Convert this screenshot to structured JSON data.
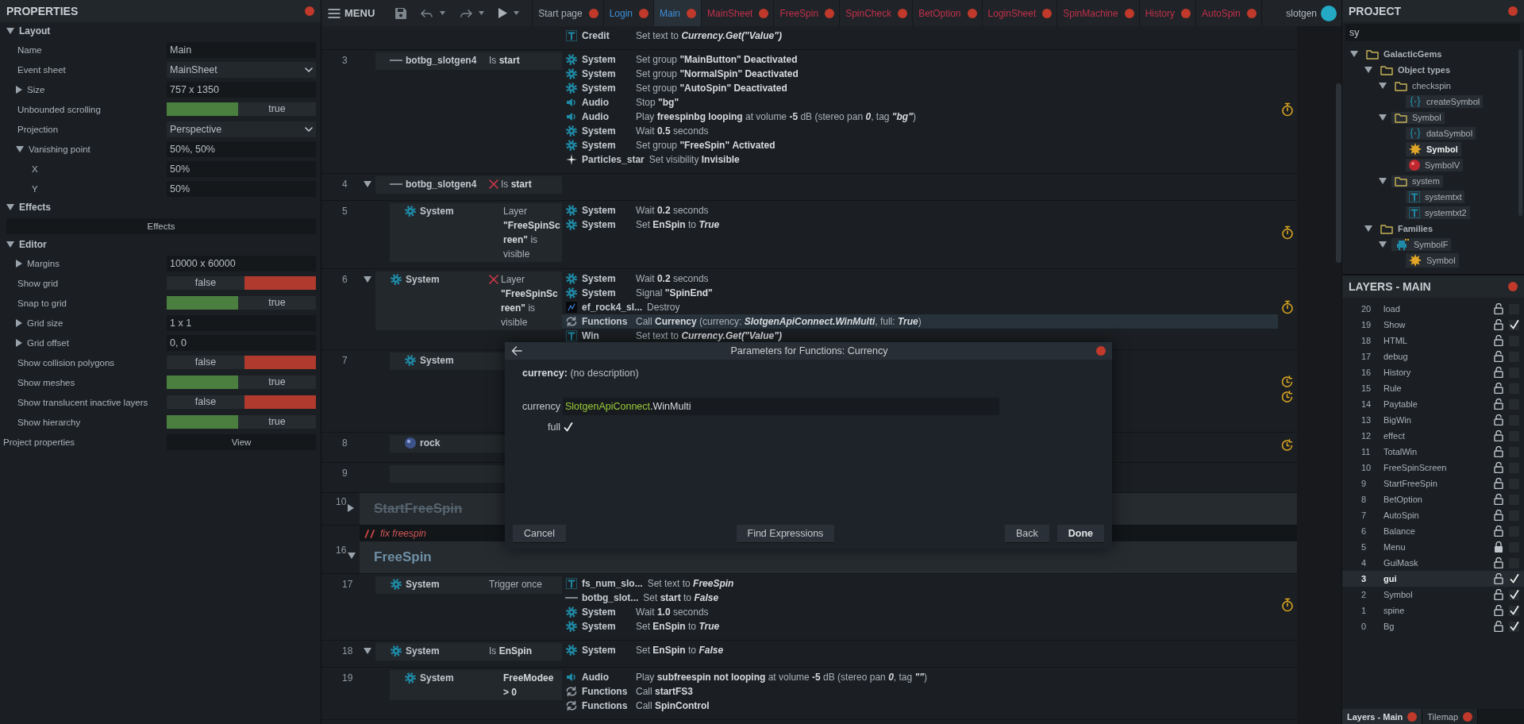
{
  "properties": {
    "title": "PROPERTIES",
    "sections": [
      {
        "title": "Layout",
        "expanded": true,
        "rows": [
          {
            "kind": "text",
            "label": "Name",
            "value": "Main"
          },
          {
            "kind": "dropdown",
            "label": "Event sheet",
            "value": "MainSheet"
          },
          {
            "kind": "text",
            "label": "Size",
            "value": "757 x 1350",
            "expanded": false
          },
          {
            "kind": "toggle",
            "label": "Unbounded scrolling",
            "on": true,
            "value": "true"
          },
          {
            "kind": "dropdown",
            "label": "Projection",
            "value": "Perspective"
          },
          {
            "kind": "text",
            "label": "Vanishing point",
            "value": "50%, 50%",
            "expanded": true,
            "children": [
              {
                "kind": "text",
                "label": "X",
                "value": "50%"
              },
              {
                "kind": "text",
                "label": "Y",
                "value": "50%"
              }
            ]
          }
        ]
      },
      {
        "title": "Effects",
        "expanded": true,
        "rows": [
          {
            "kind": "button",
            "label": "Effects"
          }
        ]
      },
      {
        "title": "Editor",
        "expanded": true,
        "rows": [
          {
            "kind": "text",
            "label": "Margins",
            "value": "10000 x 60000",
            "expanded": false
          },
          {
            "kind": "toggle",
            "label": "Show grid",
            "on": false,
            "value": "false"
          },
          {
            "kind": "toggle",
            "label": "Snap to grid",
            "on": true,
            "value": "true"
          },
          {
            "kind": "text",
            "label": "Grid size",
            "value": "1 x 1",
            "expanded": false
          },
          {
            "kind": "text",
            "label": "Grid offset",
            "value": "0, 0",
            "expanded": false
          },
          {
            "kind": "toggle",
            "label": "Show collision polygons",
            "on": false,
            "value": "false"
          },
          {
            "kind": "toggle",
            "label": "Show meshes",
            "on": true,
            "value": "true"
          },
          {
            "kind": "toggle",
            "label": "Show translucent inactive layers",
            "on": false,
            "value": "false"
          },
          {
            "kind": "toggle",
            "label": "Show hierarchy",
            "on": true,
            "value": "true"
          }
        ]
      }
    ],
    "footer": {
      "label": "Project properties",
      "button": "View"
    }
  },
  "toolbar": {
    "menu": "MENU",
    "tabs": [
      {
        "label": "Start page",
        "kind": "page",
        "selected": false
      },
      {
        "label": "Login",
        "kind": "layout",
        "selected": false
      },
      {
        "label": "Main",
        "kind": "layout",
        "selected": true
      },
      {
        "label": "MainSheet",
        "kind": "sheet",
        "selected": false
      },
      {
        "label": "FreeSpin",
        "kind": "sheet",
        "selected": false
      },
      {
        "label": "SpinCheck",
        "kind": "sheet",
        "selected": false
      },
      {
        "label": "BetOption",
        "kind": "sheet",
        "selected": false
      },
      {
        "label": "LoginSheet",
        "kind": "sheet",
        "selected": false
      },
      {
        "label": "SpinMachine",
        "kind": "sheet",
        "selected": false
      },
      {
        "label": "History",
        "kind": "sheet",
        "selected": false
      },
      {
        "label": "AutoSpin",
        "kind": "sheet",
        "selected": false
      }
    ],
    "user": "slotgen"
  },
  "event_sheet": {
    "events": [
      {
        "kind": "event",
        "actions": [
          {
            "kind": "text",
            "object": "Credit",
            "text": "Set text to *Currency.Get(\"Value\")*",
            "selected": false
          }
        ]
      },
      {
        "kind": "event",
        "number": "3",
        "conditions": [
          {
            "kind": "line",
            "object": "botbg_slotgen4",
            "text": "Is **start**",
            "inverted": false
          }
        ],
        "actions": [
          {
            "kind": "gear",
            "object": "System",
            "text": "Set group **\"MainButton\"** **Deactivated**",
            "selected": false
          },
          {
            "kind": "gear",
            "object": "System",
            "text": "Set group **\"NormalSpin\"** **Deactivated**",
            "selected": false
          },
          {
            "kind": "gear",
            "object": "System",
            "text": "Set group **\"AutoSpin\"** **Deactivated**",
            "selected": false
          },
          {
            "kind": "audio",
            "object": "Audio",
            "text": "Stop **\"bg\"**",
            "selected": false
          },
          {
            "kind": "audio",
            "object": "Audio",
            "text": "Play **freespinbg looping** at volume **-5** dB (stereo pan *0*, tag *\"bg\"*)",
            "selected": false
          },
          {
            "kind": "gear",
            "object": "System",
            "text": "Wait **0.5** seconds",
            "selected": false
          },
          {
            "kind": "gear",
            "object": "System",
            "text": "Set group **\"FreeSpin\"** **Activated**",
            "selected": false
          },
          {
            "kind": "particles",
            "object": "Particles_star",
            "text": "Set visibility **Invisible**",
            "selected": false
          }
        ],
        "markers": [
          {
            "kind": "timer"
          }
        ]
      },
      {
        "kind": "event",
        "number": "4",
        "expanded": true,
        "conditions": [
          {
            "kind": "line",
            "object": "botbg_slotgen4",
            "text": "Is **start**",
            "inverted": true
          }
        ],
        "children": [
          {
            "kind": "event",
            "number": "5",
            "conditions": [
              {
                "kind": "gear",
                "object": "System",
                "text": "Layer **\"FreeSpinScreen\"** is visible",
                "inverted": false
              }
            ],
            "actions": [
              {
                "kind": "gear",
                "object": "System",
                "text": "Wait **0.2** seconds",
                "selected": false
              },
              {
                "kind": "gear",
                "object": "System",
                "text": "Set **EnSpin** to *True*",
                "selected": false
              }
            ],
            "markers": [
              {
                "kind": "timer"
              }
            ]
          }
        ]
      },
      {
        "kind": "event",
        "number": "6",
        "expanded": true,
        "conditions": [
          {
            "kind": "gear",
            "object": "System",
            "text": "Layer **\"FreeSpinScreen\"** is visible",
            "inverted": true
          }
        ],
        "actions": [
          {
            "kind": "gear",
            "object": "System",
            "text": "Wait **0.2** seconds",
            "selected": false
          },
          {
            "kind": "gear",
            "object": "System",
            "text": "Signal **\"SpinEnd\"**",
            "selected": false
          },
          {
            "kind": "sprite",
            "object": "ef_rock4_sl...",
            "text": "Destroy",
            "selected": false
          },
          {
            "kind": "functions",
            "object": "Functions",
            "text": "Call **Currency** (currency: *SlotgenApiConnect.WinMulti*, full: *True*)",
            "selected": true
          },
          {
            "kind": "text",
            "object": "Win",
            "text": "Set text to *Currency.Get(\"Value\")*",
            "selected": false
          }
        ],
        "markers": [
          {
            "kind": "timer"
          }
        ],
        "children": [
          {
            "kind": "event",
            "number": "7",
            "conditions": [
              {
                "kind": "gear",
                "object": "System",
                "inverted": false
              }
            ],
            "markers": [
              {
                "kind": "repeat"
              },
              {
                "kind": "repeat"
              }
            ]
          },
          {
            "kind": "event",
            "number": "8",
            "conditions": [
              {
                "kind": "sphere",
                "object": "rock",
                "inverted": false
              }
            ],
            "markers": [
              {
                "kind": "repeat"
              }
            ]
          },
          {
            "kind": "event",
            "number": "9"
          }
        ]
      },
      {
        "kind": "group",
        "number": "10",
        "title": "StartFreeSpin",
        "expanded": false,
        "disabled": true
      },
      {
        "kind": "comment",
        "text": "fix freespin"
      },
      {
        "kind": "group",
        "number": "16",
        "title": "FreeSpin",
        "expanded": true,
        "disabled": false,
        "children": [
          {
            "kind": "event",
            "number": "17",
            "conditions": [
              {
                "kind": "gear",
                "object": "System",
                "text": "Trigger once",
                "inverted": false
              }
            ],
            "actions": [
              {
                "kind": "text",
                "object": "fs_num_slo...",
                "text": "Set text to *FreeSpin*",
                "selected": false
              },
              {
                "kind": "line",
                "object": "botbg_slot...",
                "text": "Set **start** to *False*",
                "selected": false
              },
              {
                "kind": "gear",
                "object": "System",
                "text": "Wait **1.0** seconds",
                "selected": false
              },
              {
                "kind": "gear",
                "object": "System",
                "text": "Set **EnSpin** to *True*",
                "selected": false
              }
            ],
            "markers": [
              {
                "kind": "timer"
              }
            ]
          },
          {
            "kind": "event",
            "number": "18",
            "expanded": true,
            "conditions": [
              {
                "kind": "gear",
                "object": "System",
                "text": "Is **EnSpin**",
                "inverted": false
              }
            ],
            "actions": [
              {
                "kind": "gear",
                "object": "System",
                "text": "Set **EnSpin** to *False*",
                "selected": false
              }
            ],
            "children": [
              {
                "kind": "event",
                "number": "19",
                "conditions": [
                  {
                    "kind": "gear",
                    "object": "System",
                    "text": "**FreeModee > 0**",
                    "inverted": false
                  }
                ],
                "actions": [
                  {
                    "kind": "audio",
                    "object": "Audio",
                    "text": "Play **subfreespin not looping** at volume **-5** dB (stereo pan *0*, tag *\"\"*)",
                    "selected": false
                  },
                  {
                    "kind": "functions",
                    "object": "Functions",
                    "text": "Call **startFS3**",
                    "selected": false
                  },
                  {
                    "kind": "functions",
                    "object": "Functions",
                    "text": "Call **SpinControl**",
                    "selected": false
                  }
                ]
              }
            ]
          }
        ]
      }
    ]
  },
  "dialog": {
    "title": "Parameters for Functions: Currency",
    "description": "**currency:** (no description)",
    "params": [
      {
        "kind": "expression",
        "label": "currency",
        "parts": [
          {
            "text": "SlotgenApiConnect",
            "kind": "object"
          },
          {
            "text": ".WinMulti",
            "kind": "plain"
          }
        ]
      },
      {
        "kind": "checkbox",
        "label": "full",
        "checked": true
      }
    ],
    "buttons": [
      {
        "label": "Cancel",
        "primary": false
      },
      {
        "label": "Find Expressions",
        "primary": false
      },
      {
        "label": "Back",
        "primary": false
      },
      {
        "label": "Done",
        "primary": true
      }
    ]
  },
  "project": {
    "title": "PROJECT",
    "search": {
      "value": "sy"
    },
    "tree": [
      {
        "label": "GalacticGems",
        "kind": "category",
        "expanded": true,
        "highlighted": false,
        "selected": false,
        "children": [
          {
            "label": "Object types",
            "kind": "category",
            "expanded": true,
            "highlighted": false,
            "selected": false,
            "children": [
              {
                "label": "checkspin",
                "kind": "folder",
                "expanded": true,
                "highlighted": false,
                "selected": false,
                "children": [
                  {
                    "label": "createSymbol",
                    "kind": "script",
                    "highlighted": true,
                    "selected": false
                  }
                ]
              },
              {
                "label": "Symbol",
                "kind": "folder",
                "expanded": true,
                "highlighted": true,
                "selected": false,
                "children": [
                  {
                    "label": "dataSymbol",
                    "kind": "script",
                    "highlighted": true,
                    "selected": false
                  },
                  {
                    "label": "Symbol",
                    "kind": "sprite",
                    "highlighted": true,
                    "selected": true
                  },
                  {
                    "label": "SymbolV",
                    "kind": "ball",
                    "highlighted": true,
                    "selected": false
                  }
                ]
              },
              {
                "label": "system",
                "kind": "folder",
                "expanded": true,
                "highlighted": true,
                "selected": false,
                "children": [
                  {
                    "label": "systemtxt",
                    "kind": "text",
                    "highlighted": true,
                    "selected": false
                  },
                  {
                    "label": "systemtxt2",
                    "kind": "text",
                    "highlighted": true,
                    "selected": false
                  }
                ]
              }
            ]
          },
          {
            "label": "Families",
            "kind": "category",
            "expanded": true,
            "highlighted": false,
            "selected": false,
            "children": [
              {
                "label": "SymbolF",
                "kind": "family",
                "expanded": true,
                "highlighted": true,
                "selected": false,
                "children": [
                  {
                    "label": "Symbol",
                    "kind": "sprite",
                    "highlighted": true,
                    "selected": false
                  }
                ]
              }
            ]
          }
        ]
      }
    ]
  },
  "layers": {
    "title": "LAYERS - MAIN",
    "items": [
      {
        "number": "20",
        "name": "load",
        "locked": false,
        "visible": false,
        "selected": false
      },
      {
        "number": "19",
        "name": "Show",
        "locked": false,
        "visible": true,
        "selected": false
      },
      {
        "number": "18",
        "name": "HTML",
        "locked": false,
        "visible": false,
        "selected": false
      },
      {
        "number": "17",
        "name": "debug",
        "locked": false,
        "visible": false,
        "selected": false
      },
      {
        "number": "16",
        "name": "History",
        "locked": false,
        "visible": false,
        "selected": false
      },
      {
        "number": "15",
        "name": "Rule",
        "locked": false,
        "visible": false,
        "selected": false
      },
      {
        "number": "14",
        "name": "Paytable",
        "locked": false,
        "visible": false,
        "selected": false
      },
      {
        "number": "13",
        "name": "BigWin",
        "locked": false,
        "visible": false,
        "selected": false
      },
      {
        "number": "12",
        "name": "effect",
        "locked": false,
        "visible": false,
        "selected": false
      },
      {
        "number": "11",
        "name": "TotalWin",
        "locked": false,
        "visible": false,
        "selected": false
      },
      {
        "number": "10",
        "name": "FreeSpinScreen",
        "locked": false,
        "visible": false,
        "selected": false
      },
      {
        "number": "9",
        "name": "StartFreeSpin",
        "locked": false,
        "visible": false,
        "selected": false
      },
      {
        "number": "8",
        "name": "BetOption",
        "locked": false,
        "visible": false,
        "selected": false
      },
      {
        "number": "7",
        "name": "AutoSpin",
        "locked": false,
        "visible": false,
        "selected": false
      },
      {
        "number": "6",
        "name": "Balance",
        "locked": false,
        "visible": false,
        "selected": false
      },
      {
        "number": "5",
        "name": "Menu",
        "locked": true,
        "visible": false,
        "selected": false
      },
      {
        "number": "4",
        "name": "GuiMask",
        "locked": false,
        "visible": false,
        "selected": false
      },
      {
        "number": "3",
        "name": "gui",
        "locked": false,
        "visible": true,
        "selected": true
      },
      {
        "number": "2",
        "name": "Symbol",
        "locked": false,
        "visible": true,
        "selected": false
      },
      {
        "number": "1",
        "name": "spine",
        "locked": false,
        "visible": true,
        "selected": false
      },
      {
        "number": "0",
        "name": "Bg",
        "locked": false,
        "visible": true,
        "selected": false
      }
    ]
  },
  "bottom_tabs": [
    {
      "label": "Layers - Main",
      "selected": true
    },
    {
      "label": "Tilemap",
      "selected": false
    }
  ]
}
